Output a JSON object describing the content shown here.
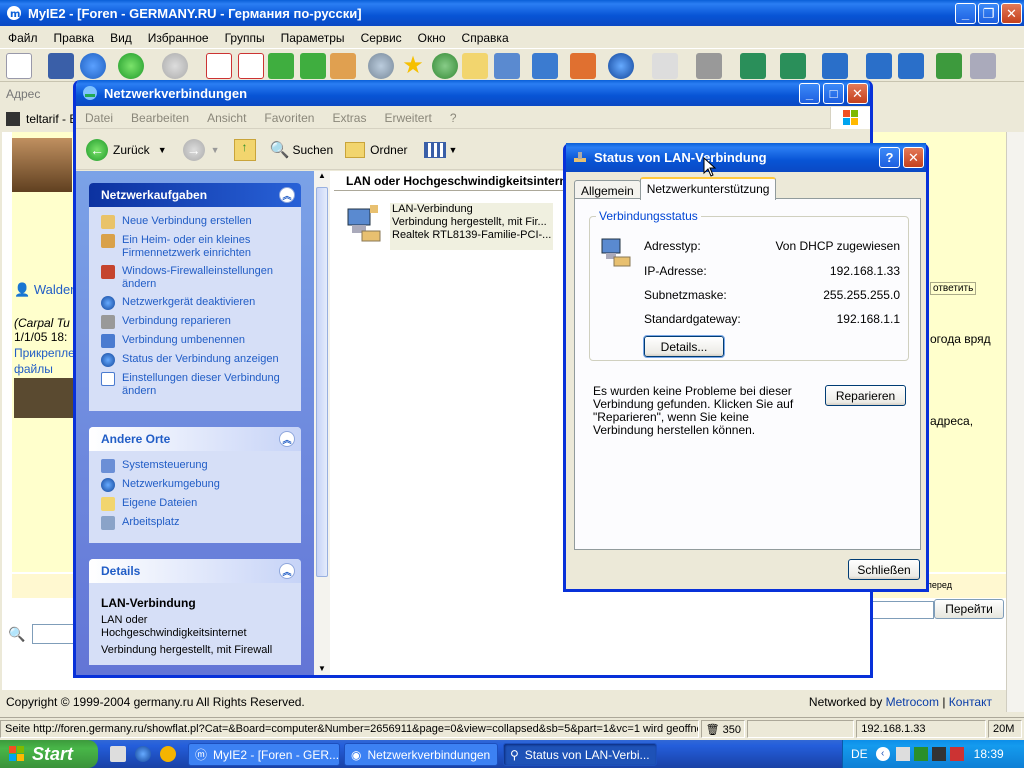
{
  "browser": {
    "title": "MyIE2 - [Foren - GERMANY.RU - Германия по-русски]",
    "menu": [
      "Файл",
      "Правка",
      "Вид",
      "Избранное",
      "Группы",
      "Параметры",
      "Сервис",
      "Окно",
      "Справка"
    ],
    "address_label": "Адрес",
    "tab_label": "teltarif - Er",
    "forum_user": "Walder",
    "forum_role": "(Carpal Tu",
    "forum_date": "1/1/05 18:",
    "forum_attach_1": "Прикрепле",
    "forum_attach_2": "файлы",
    "reply_label": "ответить",
    "right_text_1": "огода вряд",
    "right_text_2": "адреса,",
    "go_button": "Перейти",
    "next_label": "перед",
    "copyright": "Copyright © 1999-2004 germany.ru All Rights Reserved.",
    "networked_by": "Networked by",
    "metrocom": "Metrocom",
    "kontakt": "Контакт",
    "sep": "|"
  },
  "statusbar": {
    "url": "Seite http://foren.germany.ru/showflat.pl?Cat=&Board=computer&Number=2656911&page=0&view=collapsed&sb=5&part=1&vc=1 wird geoffnet",
    "count": "350",
    "ip": "192.168.1.33",
    "mem": "20M"
  },
  "explorer": {
    "title": "Netzwerkverbindungen",
    "menu": [
      "Datei",
      "Bearbeiten",
      "Ansicht",
      "Favoriten",
      "Extras",
      "Erweitert",
      "?"
    ],
    "back": "Zurück",
    "search": "Suchen",
    "folders": "Ordner",
    "tasks_title": "Netzwerkaufgaben",
    "tasks": [
      "Neue Verbindung erstellen",
      "Ein Heim- oder ein kleines Firmennetzwerk einrichten",
      "Windows-Firewalleinstellungen ändern",
      "Netzwerkgerät deaktivieren",
      "Verbindung reparieren",
      "Verbindung umbenennen",
      "Status der Verbindung anzeigen",
      "Einstellungen dieser Verbindung ändern"
    ],
    "places_title": "Andere Orte",
    "places": [
      "Systemsteuerung",
      "Netzwerkumgebung",
      "Eigene Dateien",
      "Arbeitsplatz"
    ],
    "details_title": "Details",
    "details_name": "LAN-Verbindung",
    "details_type": "LAN oder Hochgeschwindigkeitsinternet",
    "details_status": "Verbindung hergestellt, mit Firewall",
    "group_header": "LAN oder Hochgeschwindigkeitsinternet",
    "conn_name": "LAN-Verbindung",
    "conn_status": "Verbindung hergestellt, mit Fir...",
    "conn_device": "Realtek RTL8139-Familie-PCI-..."
  },
  "dialog": {
    "title": "Status von LAN-Verbindung",
    "tabs": [
      "Allgemein",
      "Netzwerkunterstützung"
    ],
    "group_label": "Verbindungsstatus",
    "rows": [
      {
        "label": "Adresstyp:",
        "value": "Von DHCP zugewiesen"
      },
      {
        "label": "IP-Adresse:",
        "value": "192.168.1.33"
      },
      {
        "label": "Subnetzmaske:",
        "value": "255.255.255.0"
      },
      {
        "label": "Standardgateway:",
        "value": "192.168.1.1"
      }
    ],
    "details_btn": "Details...",
    "message": "Es wurden keine Probleme bei dieser Verbindung gefunden. Klicken Sie auf \"Reparieren\", wenn Sie keine Verbindung herstellen können.",
    "repair_btn": "Reparieren",
    "close_btn": "Schließen"
  },
  "taskbar": {
    "start": "Start",
    "tasks": [
      "MyIE2 - [Foren - GER...",
      "Netzwerkverbindungen",
      "Status von LAN-Verbi..."
    ],
    "lang": "DE",
    "time": "18:39"
  },
  "colors": {
    "xp_blue": "#0a5fd8",
    "link_blue": "#215dc6",
    "forum_bg": "#ffffcc"
  }
}
